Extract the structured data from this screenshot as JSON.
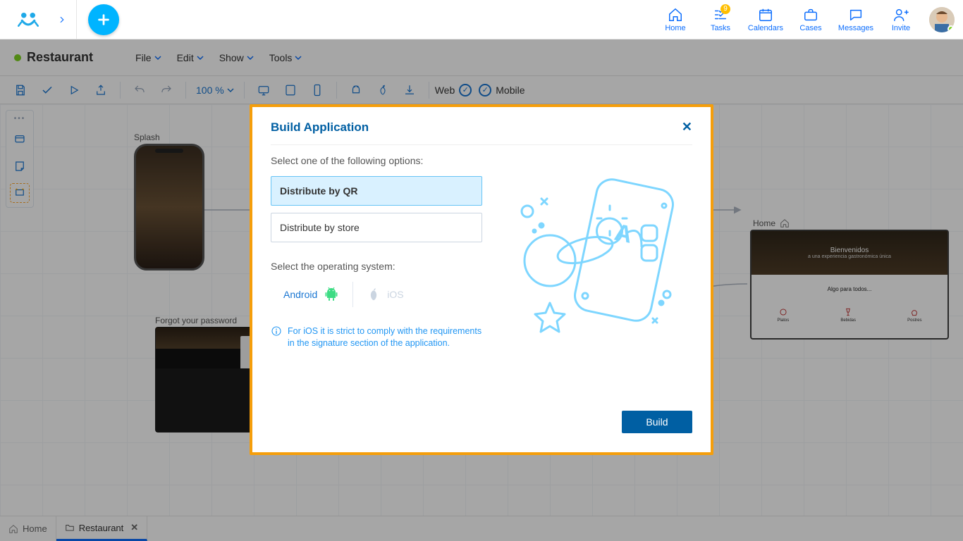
{
  "topnav": {
    "home": "Home",
    "tasks": "Tasks",
    "tasks_badge": "9",
    "calendars": "Calendars",
    "cases": "Cases",
    "messages": "Messages",
    "invite": "Invite"
  },
  "project": {
    "title": "Restaurant"
  },
  "menu": {
    "file": "File",
    "edit": "Edit",
    "show": "Show",
    "tools": "Tools"
  },
  "toolbar": {
    "zoom": "100 %",
    "web": "Web",
    "mobile": "Mobile"
  },
  "nodes": {
    "splash": "Splash",
    "forgot": "Forgot your password",
    "home_label": "Home",
    "home_hero_title": "Bienvenidos",
    "home_hero_sub": "a una experiencia gastronómica única",
    "home_band": "Algo para todos...",
    "home_c1": "Platos",
    "home_c2": "Bebidas",
    "home_c3": "Postres"
  },
  "modal": {
    "title": "Build Application",
    "instruction": "Select one of the following options:",
    "option_qr": "Distribute by QR",
    "option_store": "Distribute by store",
    "os_label": "Select the operating system:",
    "android": "Android",
    "ios": "iOS",
    "info": "For iOS it is strict to comply with the requirements in the signature section of the application.",
    "build": "Build"
  },
  "tabs": {
    "home": "Home",
    "restaurant": "Restaurant"
  }
}
